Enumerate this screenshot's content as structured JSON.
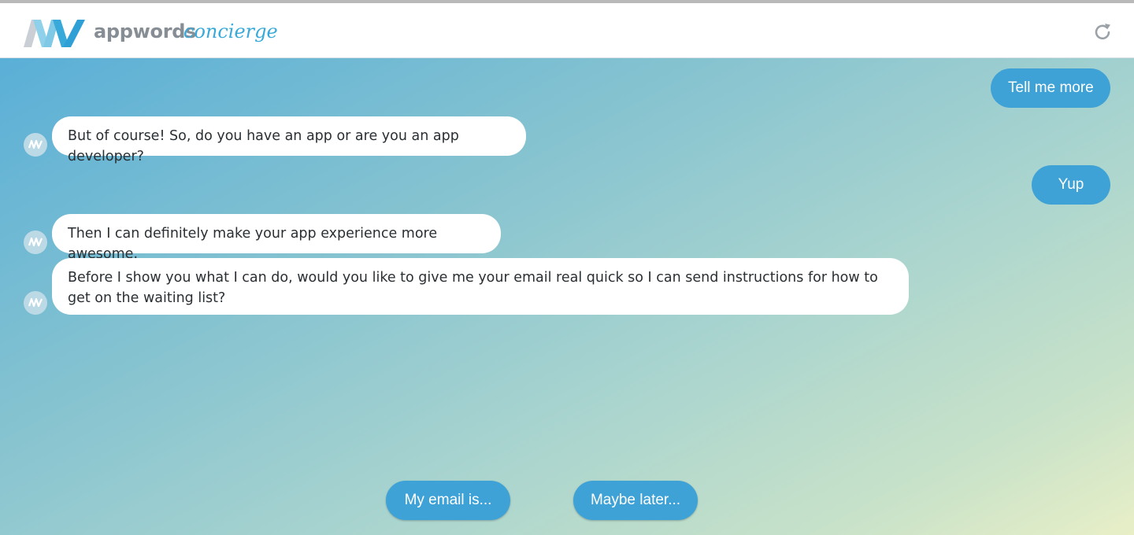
{
  "header": {
    "brand_name": "appwords",
    "brand_sub": "concierge",
    "refresh_icon": "refresh-icon"
  },
  "colors": {
    "accent": "#3fa2d6",
    "brand_gray": "#868d94",
    "brand_blue": "#39a9d9"
  },
  "messages": [
    {
      "from": "user",
      "text": "Tell me more"
    },
    {
      "from": "bot",
      "text": "But of course! So, do you have an app or are you an app developer?"
    },
    {
      "from": "user",
      "text": "Yup"
    },
    {
      "from": "bot",
      "text": "Then I can definitely make your app experience more awesome."
    },
    {
      "from": "bot",
      "text": "Before I show you what I can do, would you like to give me your email real quick so I can send instructions for how to get on the waiting list?"
    }
  ],
  "quick_replies": [
    {
      "label": "My email is..."
    },
    {
      "label": "Maybe later..."
    }
  ]
}
